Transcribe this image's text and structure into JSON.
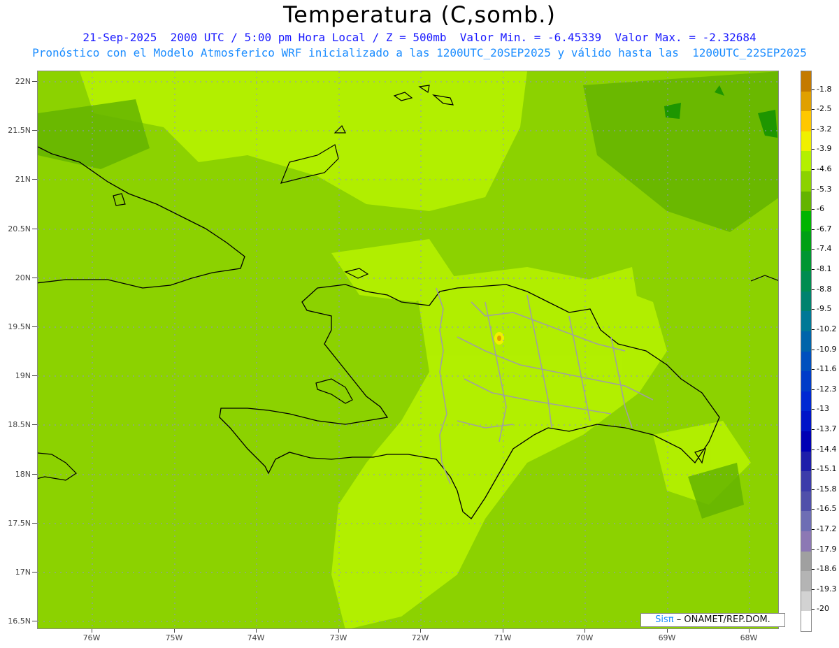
{
  "header": {
    "title": "Temperatura (C,somb.)",
    "line1": "21-Sep-2025  2000 UTC / 5:00 pm Hora Local / Z = 500mb  Valor Min. = -6.45339  Valor Max. = -2.32684",
    "line2": "Pronóstico con el Modelo Atmosferico WRF inicializado a las 1200UTC_20SEP2025 y válido hasta las  1200UTC_22SEP2025"
  },
  "axes": {
    "y_labels": [
      "22N",
      "21.5N",
      "21N",
      "20.5N",
      "20N",
      "19.5N",
      "19N",
      "18.5N",
      "18N",
      "17.5N",
      "17N",
      "16.5N"
    ],
    "x_labels": [
      "76W",
      "75W",
      "74W",
      "73W",
      "72W",
      "71W",
      "70W",
      "69W",
      "68W"
    ]
  },
  "colorbar": {
    "labels": [
      "-1.8",
      "-2.5",
      "-3.2",
      "-3.9",
      "-4.6",
      "-5.3",
      "-6",
      "-6.7",
      "-7.4",
      "-8.1",
      "-8.8",
      "-9.5",
      "-10.2",
      "-10.9",
      "-11.6",
      "-12.3",
      "-13",
      "-13.7",
      "-14.4",
      "-15.1",
      "-15.8",
      "-16.5",
      "-17.2",
      "-17.9",
      "-18.6",
      "-19.3",
      "-20"
    ],
    "colors": [
      "#c47a00",
      "#e0a000",
      "#ffc800",
      "#f0f000",
      "#b4f000",
      "#8cd200",
      "#64b400",
      "#00b400",
      "#00a014",
      "#009632",
      "#008c50",
      "#00826e",
      "#007896",
      "#0064aa",
      "#0050be",
      "#003cc8",
      "#0028d2",
      "#0014c8",
      "#0000b4",
      "#1e1eaa",
      "#3c3caa",
      "#5050aa",
      "#6e6eb4",
      "#8c78b4",
      "#a0a0a0",
      "#b4b4b4",
      "#d2d2d2",
      "#ffffff"
    ]
  },
  "credit": {
    "sis": "Sisπ",
    "text": "– ONAMET/REP.DOM."
  }
}
